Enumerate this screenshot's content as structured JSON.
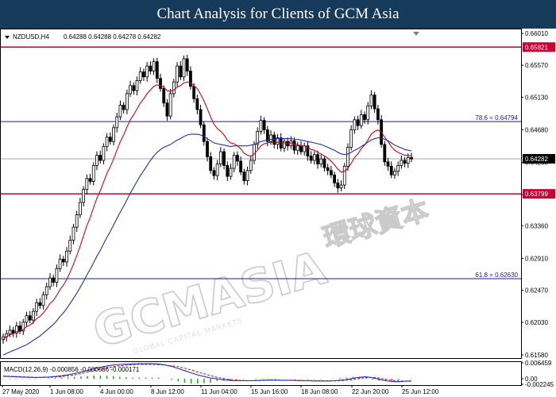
{
  "banner_title": "Chart Analysis for Clients of GCM Asia",
  "chart_header": {
    "symbol": "NZDUSD,H4",
    "ohlc": "0.64288 0.64288 0.64278 0.64282",
    "macd_label": "MACD(12,26,9) -0.000856 -0.000686 -0.000171"
  },
  "watermark": {
    "main": "GCMASIA",
    "cn": "環球資本",
    "sub": "GLOBAL CAPITAL MARKETS"
  },
  "colors": {
    "price_line": "#000000",
    "bull_candle": "#ffffff",
    "bear_candle": "#000000",
    "ma_fast": "#d9001b",
    "ma_slow": "#1f2fbf",
    "resistance_support": "#cc0033",
    "fibo_line": "#1a1a8c",
    "macd_line": "#1f2fbf",
    "signal_line": "#d9001b",
    "histogram": "#2e9e2e",
    "banner": "#163a5a"
  },
  "chart_data": {
    "type": "candlestick",
    "title": "NZDUSD,H4",
    "x_tick_labels": [
      "27 May 2020",
      "1 Jun 08:00",
      "4 Jun 00:00",
      "8 Jun 12:00",
      "11 Jun 04:00",
      "15 Jun 16:00",
      "18 Jun 08:00",
      "22 Jun 20:00",
      "25 Jun 12:00"
    ],
    "price_axis_labels": [
      "0.66010",
      "0.65570",
      "0.65130",
      "0.64680",
      "0.64230",
      "0.63790",
      "0.63360",
      "0.62910",
      "0.62470",
      "0.62030",
      "0.61580"
    ],
    "ylim": [
      0.6158,
      0.6601
    ],
    "current_price": {
      "value": 0.64282,
      "label": "0.64282"
    },
    "levels": [
      {
        "name": "resistance",
        "value": 0.65821,
        "label": "0.65821"
      },
      {
        "name": "support",
        "value": 0.63799,
        "label": "0.63799"
      }
    ],
    "fibonacci": [
      {
        "value": 0.64794,
        "text": "78.6  = 0.64794"
      },
      {
        "value": 0.6263,
        "text": "61.8  = 0.62630"
      }
    ],
    "price_series": [
      0.6183,
      0.6187,
      0.6192,
      0.6188,
      0.6198,
      0.6191,
      0.6203,
      0.6212,
      0.6206,
      0.6218,
      0.623,
      0.6226,
      0.6241,
      0.6252,
      0.6264,
      0.6258,
      0.6277,
      0.629,
      0.6286,
      0.6301,
      0.6316,
      0.6334,
      0.6351,
      0.6368,
      0.6386,
      0.6401,
      0.6397,
      0.6419,
      0.6433,
      0.6426,
      0.6445,
      0.6458,
      0.6452,
      0.6471,
      0.6486,
      0.6502,
      0.6496,
      0.6518,
      0.6529,
      0.6522,
      0.6536,
      0.6548,
      0.6541,
      0.6556,
      0.6549,
      0.6562,
      0.6539,
      0.6525,
      0.6505,
      0.6487,
      0.6518,
      0.6534,
      0.6556,
      0.6541,
      0.6566,
      0.6549,
      0.6528,
      0.6511,
      0.6496,
      0.6475,
      0.6452,
      0.6431,
      0.6412,
      0.6405,
      0.6421,
      0.6438,
      0.6419,
      0.6404,
      0.6415,
      0.6433,
      0.6425,
      0.641,
      0.6398,
      0.6412,
      0.6426,
      0.6448,
      0.6466,
      0.6481,
      0.6468,
      0.6452,
      0.6461,
      0.6448,
      0.6457,
      0.6443,
      0.6452,
      0.6446,
      0.6453,
      0.644,
      0.6446,
      0.6438,
      0.6446,
      0.6432,
      0.6426,
      0.6434,
      0.6421,
      0.6428,
      0.6416,
      0.6412,
      0.6406,
      0.6395,
      0.6388,
      0.6392,
      0.6418,
      0.6444,
      0.6468,
      0.6482,
      0.6474,
      0.6489,
      0.6482,
      0.6501,
      0.6516,
      0.6497,
      0.6482,
      0.6448,
      0.6424,
      0.6418,
      0.6406,
      0.6411,
      0.6419,
      0.6426,
      0.6422,
      0.643,
      0.6428
    ],
    "ma_fast": [
      0.618,
      0.6183,
      0.6186,
      0.6187,
      0.619,
      0.619,
      0.6193,
      0.6197,
      0.6199,
      0.6203,
      0.6208,
      0.6211,
      0.6216,
      0.6222,
      0.6229,
      0.6233,
      0.624,
      0.6248,
      0.6254,
      0.6262,
      0.6272,
      0.6283,
      0.6295,
      0.6308,
      0.6322,
      0.6336,
      0.6347,
      0.6361,
      0.6374,
      0.6384,
      0.6396,
      0.6408,
      0.6417,
      0.6428,
      0.644,
      0.6452,
      0.6461,
      0.6472,
      0.6482,
      0.6489,
      0.6497,
      0.6505,
      0.6511,
      0.6518,
      0.6523,
      0.6528,
      0.653,
      0.6529,
      0.6527,
      0.6522,
      0.6521,
      0.6523,
      0.6527,
      0.6529,
      0.6533,
      0.6534,
      0.6533,
      0.6529,
      0.6525,
      0.6517,
      0.6508,
      0.6497,
      0.6486,
      0.6476,
      0.647,
      0.6466,
      0.6461,
      0.6454,
      0.645,
      0.6449,
      0.6446,
      0.6442,
      0.6436,
      0.6433,
      0.6432,
      0.6435,
      0.644,
      0.6446,
      0.6449,
      0.645,
      0.6451,
      0.645,
      0.6451,
      0.645,
      0.645,
      0.6449,
      0.645,
      0.6448,
      0.6448,
      0.6446,
      0.6446,
      0.6444,
      0.6441,
      0.644,
      0.6437,
      0.6435,
      0.6432,
      0.6429,
      0.6425,
      0.642,
      0.6414,
      0.641,
      0.6411,
      0.6415,
      0.6422,
      0.643,
      0.6435,
      0.6442,
      0.6447,
      0.6454,
      0.6462,
      0.6466,
      0.6468,
      0.6465,
      0.6458,
      0.6452,
      0.6445,
      0.644,
      0.6437,
      0.6435,
      0.6433,
      0.6433,
      0.6432
    ],
    "ma_slow": [
      0.6158,
      0.616,
      0.6162,
      0.6164,
      0.6166,
      0.6168,
      0.617,
      0.6172,
      0.6175,
      0.6178,
      0.6181,
      0.6184,
      0.6188,
      0.6192,
      0.6196,
      0.62,
      0.6205,
      0.6211,
      0.6216,
      0.6222,
      0.6229,
      0.6236,
      0.6243,
      0.6251,
      0.6259,
      0.6268,
      0.6276,
      0.6285,
      0.6294,
      0.6302,
      0.6311,
      0.632,
      0.6328,
      0.6337,
      0.6346,
      0.6355,
      0.6363,
      0.6372,
      0.6381,
      0.6389,
      0.6397,
      0.6405,
      0.6412,
      0.6419,
      0.6426,
      0.6432,
      0.6437,
      0.6441,
      0.6444,
      0.6446,
      0.6448,
      0.6451,
      0.6454,
      0.6456,
      0.6459,
      0.6461,
      0.6462,
      0.6462,
      0.6462,
      0.6461,
      0.6459,
      0.6456,
      0.6453,
      0.645,
      0.6449,
      0.6448,
      0.6447,
      0.6446,
      0.6445,
      0.6446,
      0.6446,
      0.6446,
      0.6446,
      0.6446,
      0.6447,
      0.6448,
      0.645,
      0.6452,
      0.6453,
      0.6454,
      0.6455,
      0.6455,
      0.6456,
      0.6456,
      0.6456,
      0.6456,
      0.6456,
      0.6455,
      0.6455,
      0.6454,
      0.6453,
      0.6452,
      0.6451,
      0.645,
      0.6449,
      0.6448,
      0.6446,
      0.6444,
      0.6442,
      0.644,
      0.6437,
      0.6435,
      0.6434,
      0.6435,
      0.6437,
      0.644,
      0.6442,
      0.6445,
      0.6448,
      0.6451,
      0.6454,
      0.6456,
      0.6457,
      0.6457,
      0.6455,
      0.6453,
      0.645,
      0.6447,
      0.6445,
      0.6443,
      0.6441,
      0.644,
      0.6439
    ],
    "macd": {
      "axis_labels": [
        "0.006459",
        "0.00",
        "-0.002245"
      ],
      "ylim": [
        -0.002245,
        0.006459
      ],
      "macd_values": [
        0.001,
        0.0009,
        0.0008,
        0.0007,
        0.0006,
        0.0005,
        0.0006,
        0.0007,
        0.0009,
        0.0012,
        0.0016,
        0.0021,
        0.0027,
        0.0034,
        0.0041,
        0.0047,
        0.0052,
        0.0056,
        0.0058,
        0.0059,
        0.006,
        0.0061,
        0.0061,
        0.0061,
        0.006,
        0.0056,
        0.005,
        0.0042,
        0.0033,
        0.0024,
        0.0016,
        0.0009,
        0.0003,
        0.0,
        -0.0004,
        -0.0007,
        -0.0008,
        -0.0008,
        -0.0008,
        -0.0007,
        -0.0006,
        -0.0005,
        -0.0005,
        -0.0006,
        -0.0006,
        -0.0007,
        -0.0008,
        -0.0008,
        -0.0009,
        -0.0009,
        -0.0009,
        -0.0008,
        -0.0006,
        -0.0003,
        0.0002,
        0.0006,
        0.0008,
        0.0004,
        -0.0002,
        -0.0008,
        -0.0011,
        -0.0012,
        -0.001,
        -0.0009
      ],
      "signal_values": [
        0.0011,
        0.001,
        0.0009,
        0.0008,
        0.0007,
        0.0006,
        0.0006,
        0.0006,
        0.0007,
        0.0009,
        0.0012,
        0.0016,
        0.0021,
        0.0027,
        0.0033,
        0.0039,
        0.0044,
        0.0049,
        0.0053,
        0.0055,
        0.0057,
        0.0058,
        0.0058,
        0.0058,
        0.0057,
        0.0056,
        0.0053,
        0.0049,
        0.0043,
        0.0036,
        0.0028,
        0.002,
        0.0013,
        0.0006,
        0.0001,
        -0.0003,
        -0.0006,
        -0.0007,
        -0.0008,
        -0.0008,
        -0.0007,
        -0.0006,
        -0.0006,
        -0.0006,
        -0.0006,
        -0.0006,
        -0.0007,
        -0.0007,
        -0.0008,
        -0.0008,
        -0.0009,
        -0.0009,
        -0.0008,
        -0.0006,
        -0.0003,
        0.0001,
        0.0005,
        0.0006,
        0.0003,
        -0.0002,
        -0.0006,
        -0.0009,
        -0.001,
        -0.001
      ],
      "histogram_values": [
        -0.0001,
        -0.0001,
        -0.0001,
        -0.0001,
        -0.0001,
        -0.0001,
        0.0,
        0.0001,
        0.0002,
        0.0003,
        0.0004,
        0.0005,
        0.0006,
        0.0007,
        0.0008,
        0.0008,
        0.0008,
        0.0007,
        0.0005,
        0.0004,
        0.0003,
        0.0003,
        0.0003,
        0.0003,
        0.0003,
        0.0,
        -0.0003,
        -0.0007,
        -0.001,
        -0.0012,
        -0.0012,
        -0.0011,
        -0.001,
        -0.0006,
        -0.0005,
        -0.0004,
        -0.0002,
        -0.0001,
        0.0,
        0.0001,
        0.0001,
        0.0001,
        0.0001,
        0.0,
        0.0,
        -0.0001,
        -0.0001,
        -0.0001,
        -0.0001,
        -0.0001,
        0.0,
        0.0001,
        0.0002,
        0.0003,
        0.0005,
        0.0005,
        0.0003,
        -0.0002,
        -0.0005,
        -0.0006,
        -0.0005,
        -0.0003,
        0.0,
        0.0001
      ]
    }
  }
}
